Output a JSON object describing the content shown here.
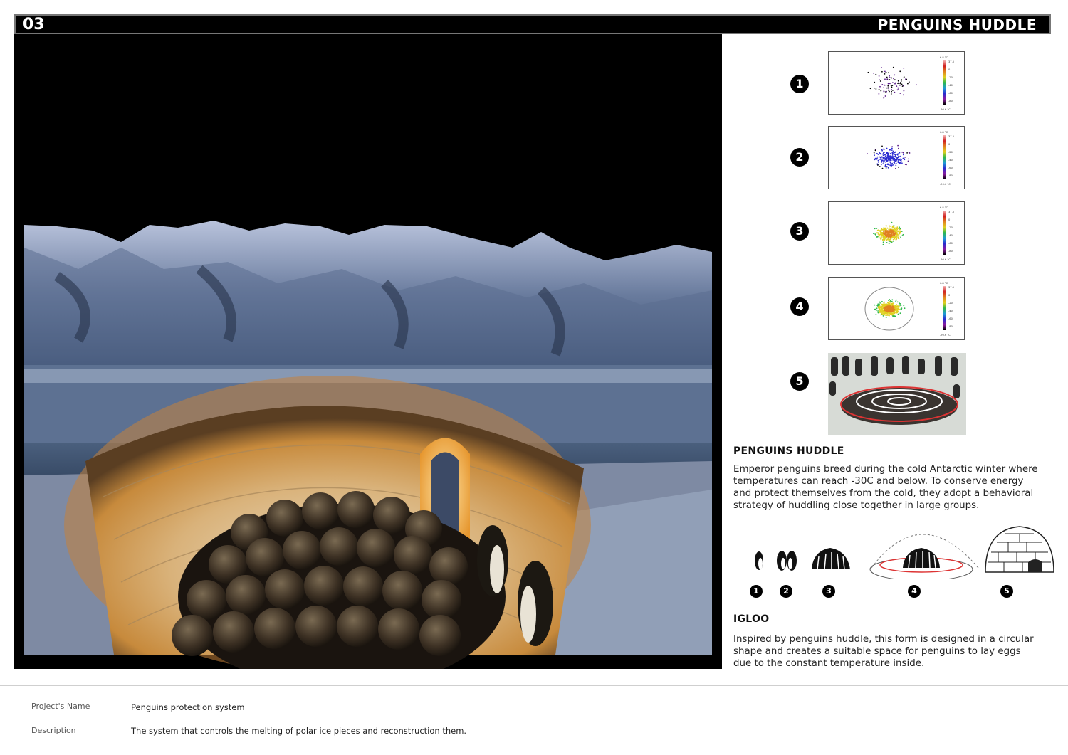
{
  "header": {
    "number": "03",
    "title": "PENGUINS HUDDLE"
  },
  "steps": [
    "1",
    "2",
    "3",
    "4",
    "5"
  ],
  "colorbar_ticks": [
    "6.8 °C",
    "37.5",
    "0",
    "-20",
    "-40",
    "-60",
    "-80",
    "-90.6 °C"
  ],
  "huddle": {
    "title": "PENGUINS HUDDLE",
    "text": "Emperor penguins breed during the cold Antarctic winter where temperatures can reach -30C and below. To conserve energy and protect themselves from the cold, they adopt a behavioral strategy of huddling close together in large groups."
  },
  "diagram_steps": [
    "1",
    "2",
    "3",
    "4",
    "5"
  ],
  "igloo": {
    "title": "IGLOO",
    "text": "Inspired by penguins huddle, this form is designed in a circular shape and creates a suitable space for penguins to lay eggs due to the constant temperature inside."
  },
  "footer": {
    "project_label": "Project's Name",
    "project_value": "Penguins protection system",
    "description_label": "Description",
    "description_value": "The system that controls the melting of polar ice pieces and reconstruction them."
  },
  "colors": {
    "header_bg": "#000000",
    "accent_glow": "#f0a640",
    "ice": "#3c5575"
  }
}
